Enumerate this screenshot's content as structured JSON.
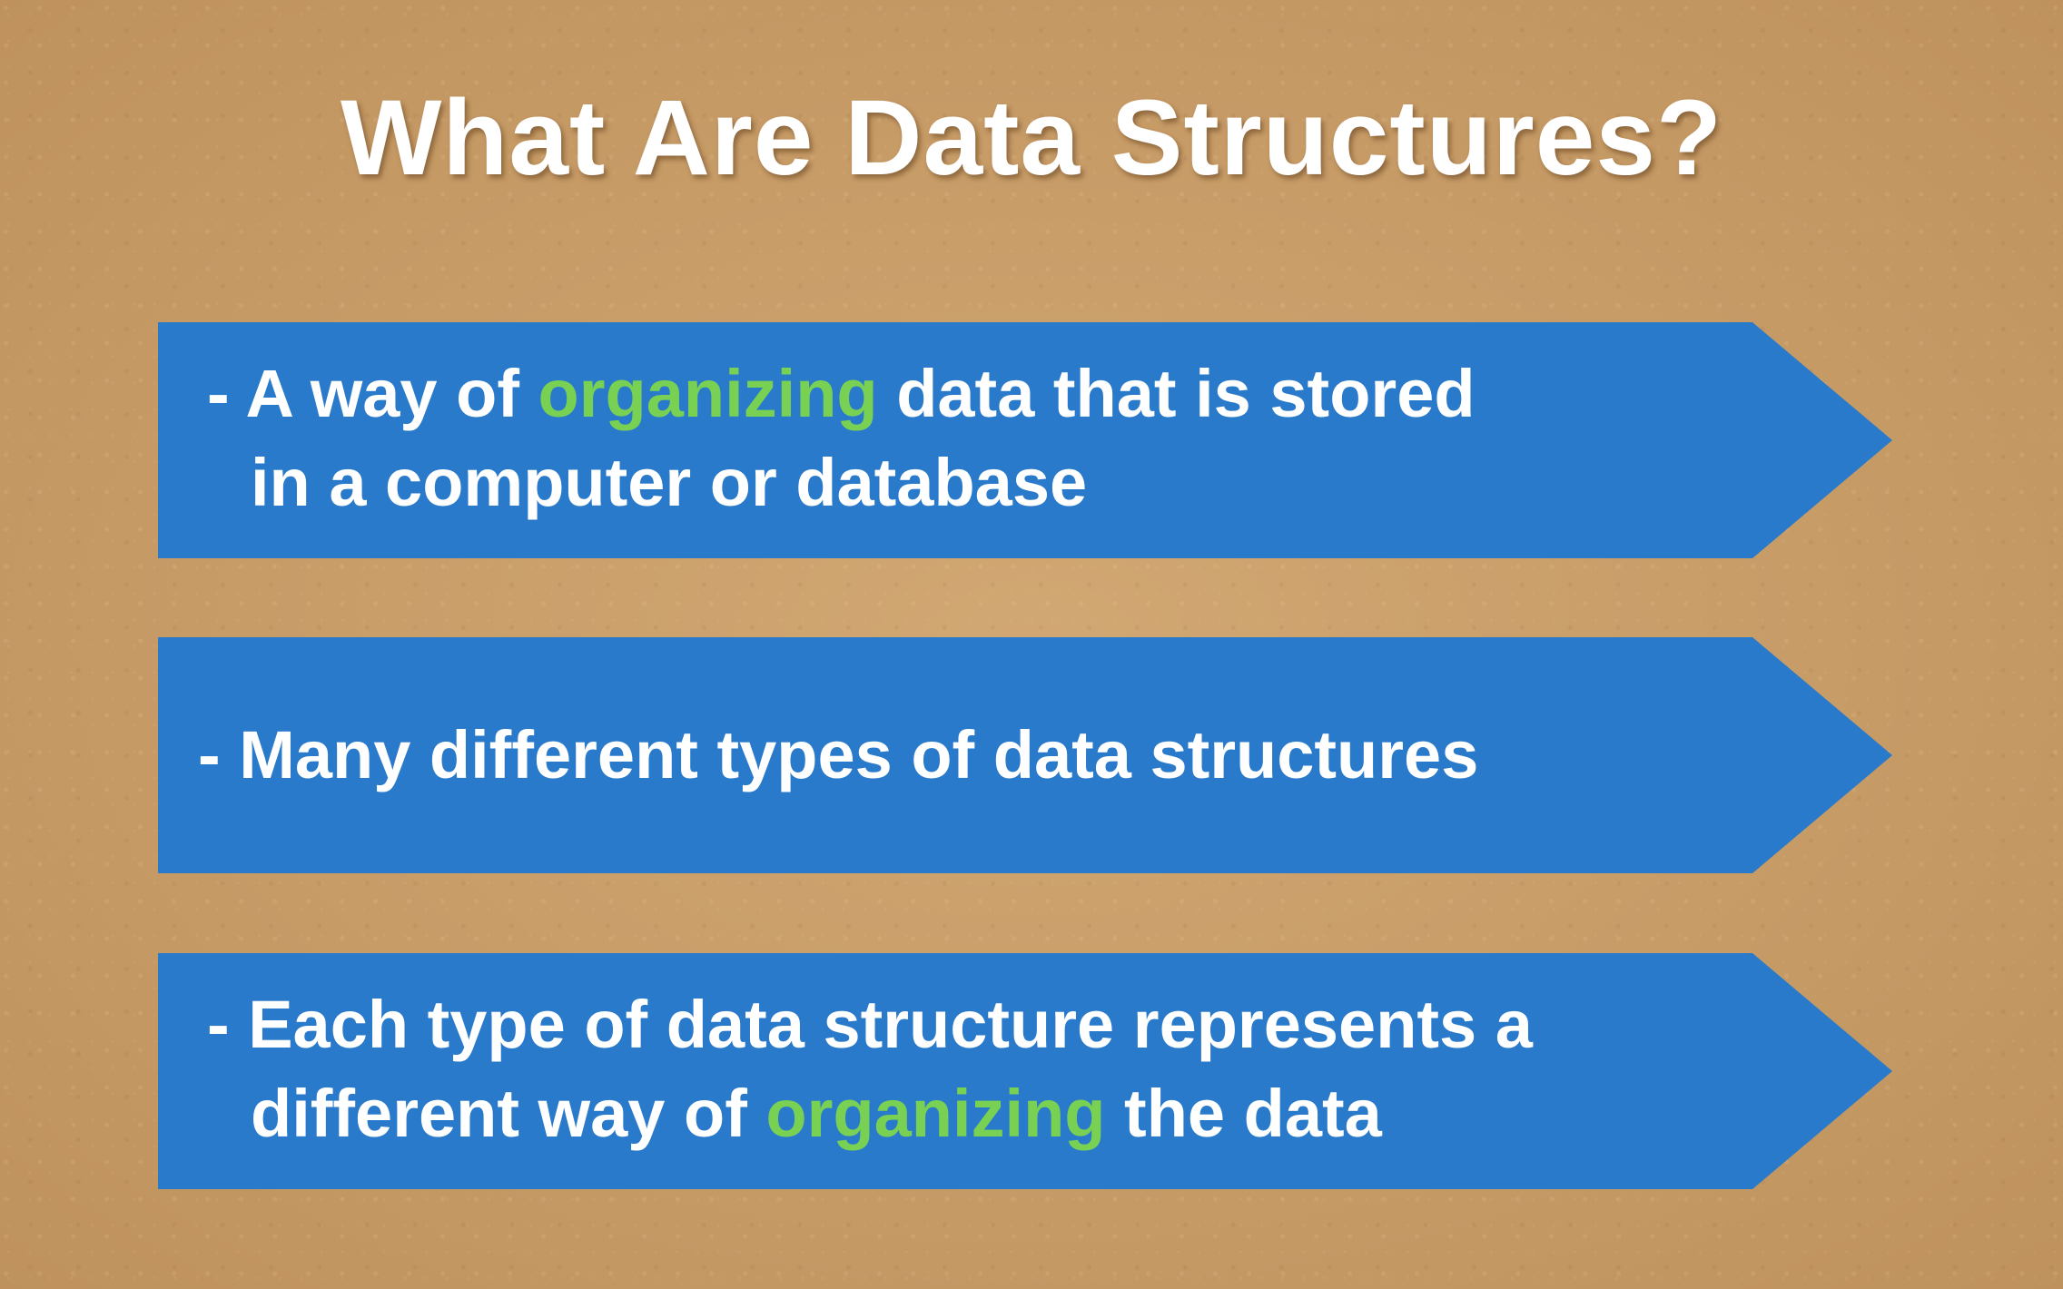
{
  "slide": {
    "title": "What Are Data Structures?",
    "colors": {
      "background": "#c79a63",
      "arrow": "#2a7acb",
      "text": "#ffffff",
      "highlight": "#79d153"
    },
    "points": [
      {
        "line1_before": "- A way of ",
        "line1_highlight": "organizing",
        "line1_after": " data that is stored",
        "line2": "in a computer or database"
      },
      {
        "line1": "- Many different types of data structures"
      },
      {
        "line1": "- Each type of data structure represents a",
        "line2_before": "different way of ",
        "line2_highlight": "organizing",
        "line2_after": " the data"
      }
    ]
  }
}
